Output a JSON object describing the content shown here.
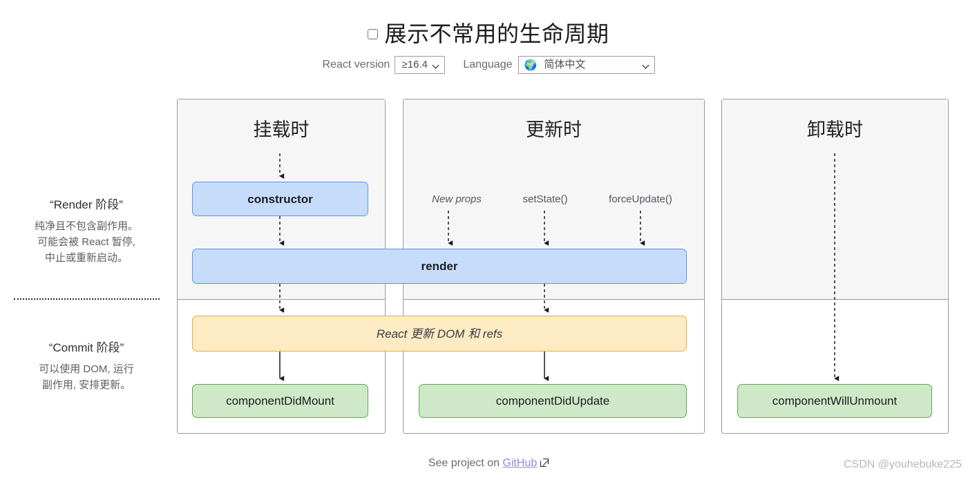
{
  "header": {
    "title": "展示不常用的生命周期",
    "checkbox_checked": false,
    "react_version_label": "React version",
    "react_version_value": "≥16.4",
    "language_label": "Language",
    "language_value": "简体中文",
    "language_icon": "globe-icon"
  },
  "sidebar": {
    "render_phase": {
      "title": "“Render 阶段”",
      "line1": "纯净且不包含副作用。",
      "line2": "可能会被 React 暂停,",
      "line3": "中止或重新启动。"
    },
    "commit_phase": {
      "title": "“Commit 阶段”",
      "line1": "可以使用 DOM, 运行",
      "line2": "副作用, 安排更新。"
    }
  },
  "columns": {
    "mount": "挂载时",
    "update": "更新时",
    "unmount": "卸载时"
  },
  "triggers": {
    "new_props": "New props",
    "set_state": "setState()",
    "force_update": "forceUpdate()"
  },
  "nodes": {
    "constructor": "constructor",
    "render": "render",
    "dom_update": "React 更新 DOM 和 refs",
    "did_mount": "componentDidMount",
    "did_update": "componentDidUpdate",
    "will_unmount": "componentWillUnmount"
  },
  "footer": {
    "text": "See project on",
    "link": "GitHub",
    "link_icon": "external-link-icon",
    "watermark": "CSDN @youhebuke225"
  },
  "colors": {
    "node_blue_fill": "#c7dcfb",
    "node_blue_border": "#5b95e8",
    "node_green_fill": "#cee8c8",
    "node_green_border": "#5fa755",
    "node_yellow_fill": "#fcebc3",
    "node_yellow_border": "#e3ad3c",
    "render_phase_bg": "#f6f6f6",
    "link": "#8b8bdd"
  }
}
